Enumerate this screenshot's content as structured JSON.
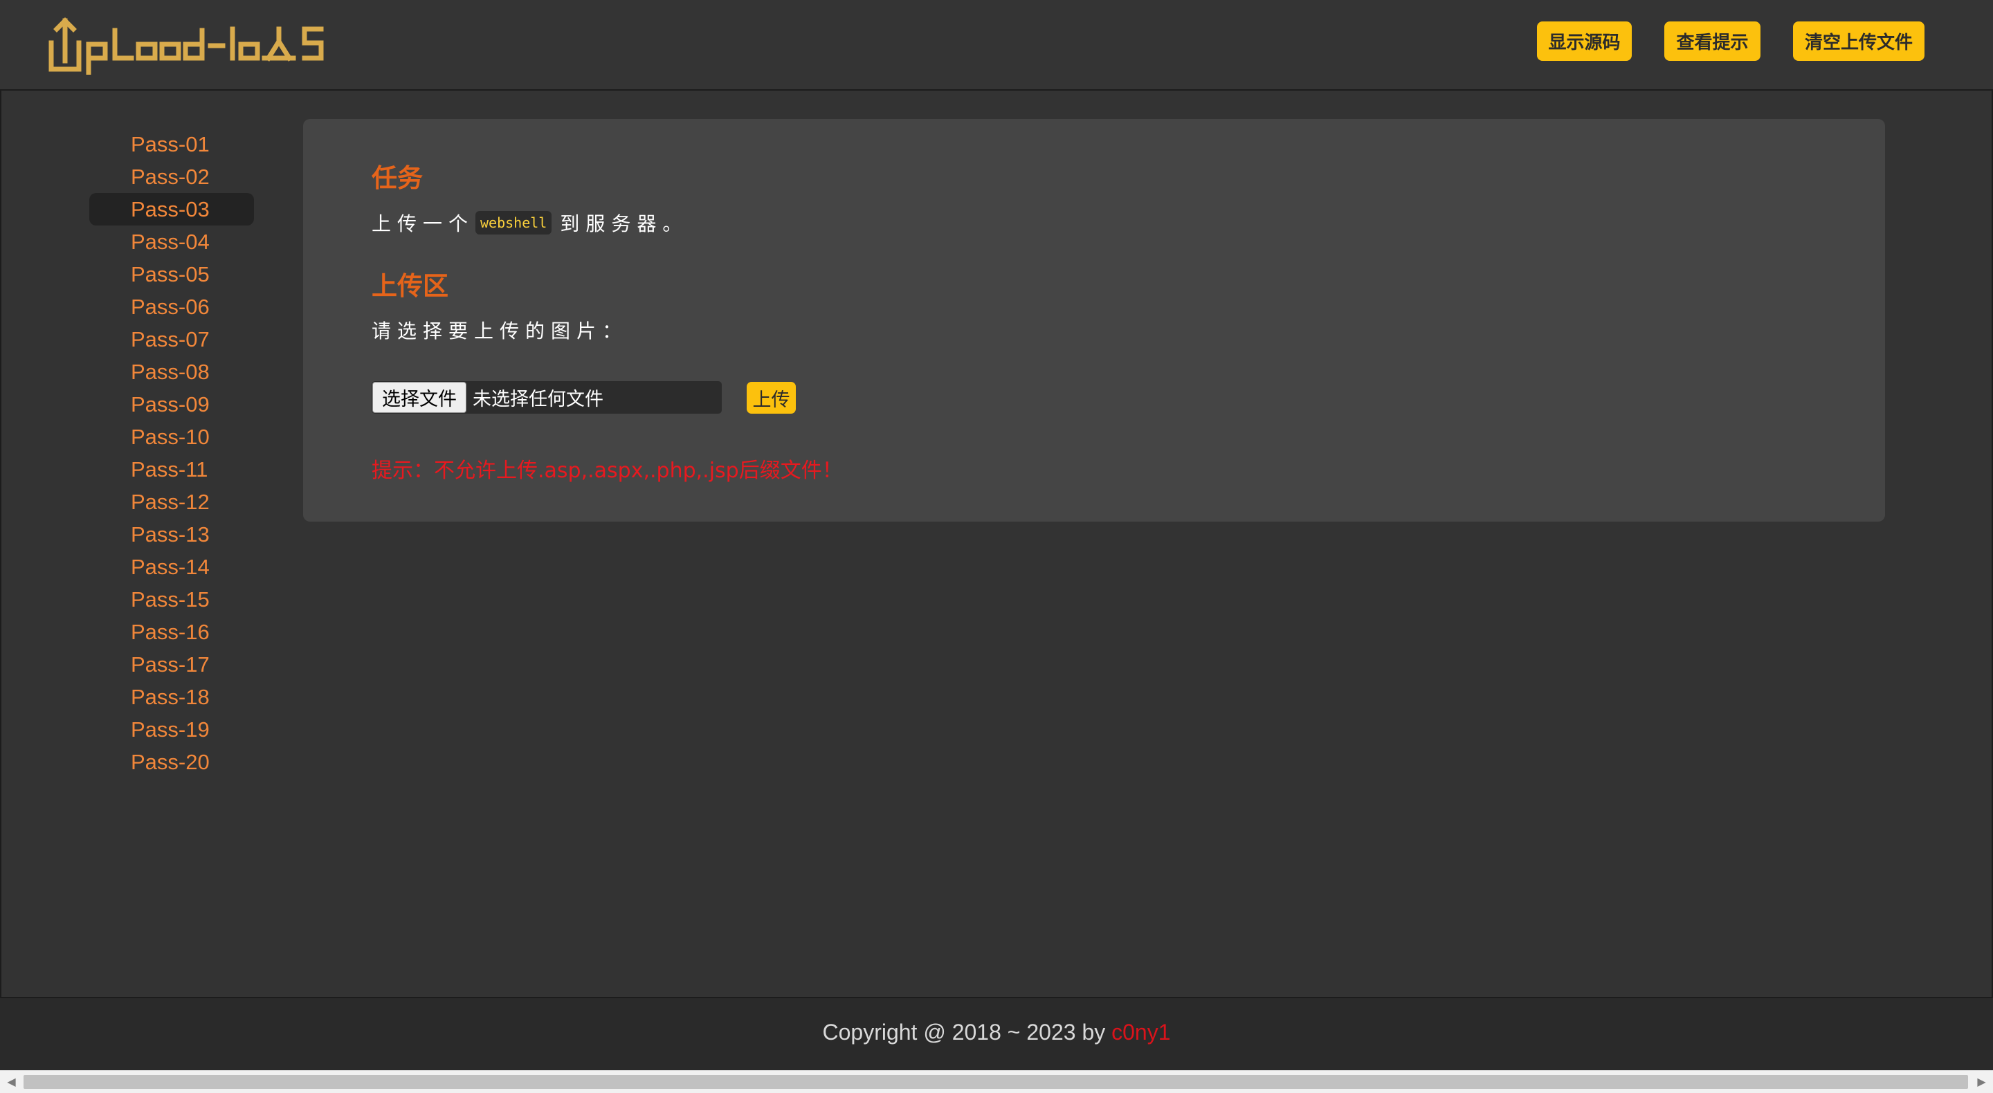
{
  "header": {
    "logo_text": "Upload-labs",
    "buttons": {
      "show_source": "显示源码",
      "view_hint": "查看提示",
      "clear_uploads": "清空上传文件"
    }
  },
  "sidebar": {
    "active_index": 2,
    "items": [
      {
        "label": "Pass-01"
      },
      {
        "label": "Pass-02"
      },
      {
        "label": "Pass-03"
      },
      {
        "label": "Pass-04"
      },
      {
        "label": "Pass-05"
      },
      {
        "label": "Pass-06"
      },
      {
        "label": "Pass-07"
      },
      {
        "label": "Pass-08"
      },
      {
        "label": "Pass-09"
      },
      {
        "label": "Pass-10"
      },
      {
        "label": "Pass-11"
      },
      {
        "label": "Pass-12"
      },
      {
        "label": "Pass-13"
      },
      {
        "label": "Pass-14"
      },
      {
        "label": "Pass-15"
      },
      {
        "label": "Pass-16"
      },
      {
        "label": "Pass-17"
      },
      {
        "label": "Pass-18"
      },
      {
        "label": "Pass-19"
      },
      {
        "label": "Pass-20"
      }
    ]
  },
  "main": {
    "task": {
      "title": "任务",
      "text_before": "上传一个",
      "code": "webshell",
      "text_after": "到服务器。"
    },
    "upload": {
      "title": "上传区",
      "choose_label": "请选择要上传的图片：",
      "file_button_label": "选择文件",
      "file_status": "未选择任何文件",
      "submit_label": "上传"
    },
    "tip": "提示：不允许上传.asp,.aspx,.php,.jsp后缀文件！"
  },
  "footer": {
    "copyright": "Copyright @ 2018 ~ 2023 by ",
    "author": "c0ny1"
  },
  "scrollbar": {
    "left_arrow": "◀",
    "right_arrow": "▶"
  },
  "colors": {
    "accent_yellow": "#fcc10d",
    "logo_gold": "#d9ab4c",
    "link_orange": "#f2873a",
    "title_orange": "#e6641a",
    "warning_red": "#e8191f",
    "author_red": "#d9131b"
  }
}
